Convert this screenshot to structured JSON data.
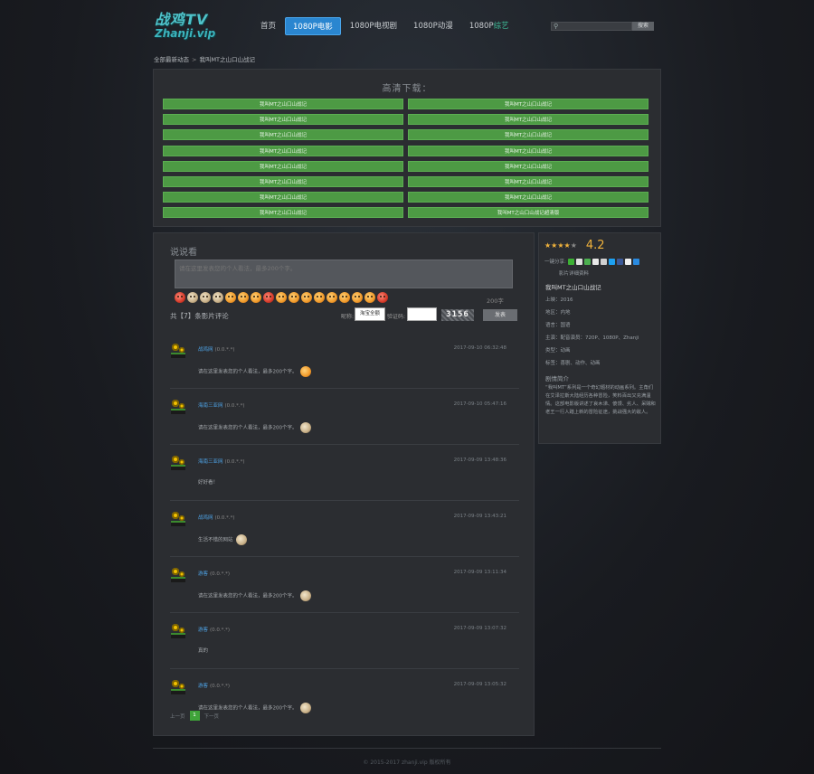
{
  "header": {
    "logo_line1": "战鸡TV",
    "logo_line2": "Zhanji.vip",
    "nav": [
      {
        "label": "首页",
        "active": false
      },
      {
        "label": "1080P电影",
        "active": true
      },
      {
        "label": "1080P电视剧",
        "active": false
      },
      {
        "label": "1080P动漫",
        "active": false
      },
      {
        "label": "1080P",
        "highlight": "综艺",
        "active": false
      }
    ],
    "search_placeholder": "",
    "search_button": "搜索"
  },
  "breadcrumb": [
    "全部最新动态",
    "我叫MT之山口山战记"
  ],
  "download": {
    "title": "高清下载：",
    "links": [
      "我叫MT之山口山战记",
      "我叫MT之山口山战记",
      "我叫MT之山口山战记",
      "我叫MT之山口山战记",
      "我叫MT之山口山战记",
      "我叫MT之山口山战记",
      "我叫MT之山口山战记",
      "我叫MT之山口山战记",
      "我叫MT之山口山战记",
      "我叫MT之山口山战记",
      "我叫MT之山口山战记",
      "我叫MT之山口山战记",
      "我叫MT之山口山战记",
      "我叫MT之山口山战记",
      "我叫MT之山口山战记",
      "我叫MT之山口山战记超清版"
    ]
  },
  "comments": {
    "title": "说说看",
    "textarea_placeholder": "请在这里发表您的个人看法，最多200个字。",
    "count_text": "200字",
    "total_text": "共【7】条影片评论",
    "nick_label": "昵称:",
    "nick_value": "淘宝全额",
    "code_label": "验证码:",
    "captcha": "3156",
    "submit": "发表",
    "items": [
      {
        "name": "战鸡网",
        "ver": "(0.0.*.*)",
        "time": "2017-09-10 06:32:48",
        "text": "请在这里发表您的个人看法，最多200个字。",
        "face": "orange"
      },
      {
        "name": "海南三亚网",
        "ver": "(0.0.*.*)",
        "time": "2017-09-10 05:47:16",
        "text": "请在这里发表您的个人看法，最多200个字。",
        "face": "grey"
      },
      {
        "name": "海南三亚网",
        "ver": "(0.0.*.*)",
        "time": "2017-09-09 13:48:36",
        "text": "好好看！",
        "face": ""
      },
      {
        "name": "战鸡网",
        "ver": "(0.0.*.*)",
        "time": "2017-09-09 13:43:21",
        "text": "生活不错的网站",
        "face": "grey"
      },
      {
        "name": "游客",
        "ver": "(0.0.*.*)",
        "time": "2017-09-09 13:11:34",
        "text": "请在这里发表您的个人看法，最多200个字。",
        "face": "orange"
      },
      {
        "name": "游客",
        "ver": "(0.0.*.*)",
        "time": "2017-09-09 13:07:32",
        "text": "真的",
        "face": ""
      },
      {
        "name": "游客",
        "ver": "(0.0.*.*)",
        "time": "2017-09-09 13:05:32",
        "text": "请在这里发表您的个人看法，最多200个字。",
        "face": "grey"
      }
    ],
    "pager": {
      "prev": "上一页",
      "current": "1",
      "next": "下一页"
    }
  },
  "info": {
    "score": "4.2",
    "stars_on": 4,
    "share_label": "一键分享:",
    "category": "影片详细资料",
    "title": "我叫MT之山口山战记",
    "year": "上映：2016",
    "area": "地区：内地",
    "language": "语言：国语",
    "director": "导演：导演",
    "actors": "主演：配音演员：720P、1080P、Zhanji",
    "genre": "类型：动画",
    "tags": "标签：喜剧、动作、动画",
    "intro_title": "剧情简介",
    "intro": "“我叫MT”系列是一个奇幻题材的动画系列。主角们在艾泽拉斯大陆经历各种冒险，笑料百出又充满温情。这部电影版讲述了哀木涕、傻馒、劣人、呆贼和老王一行人踏上新的冒险征途，挑战强大的敌人。"
  },
  "footer": "© 2015-2017 zhanji.vip 版权所有"
}
